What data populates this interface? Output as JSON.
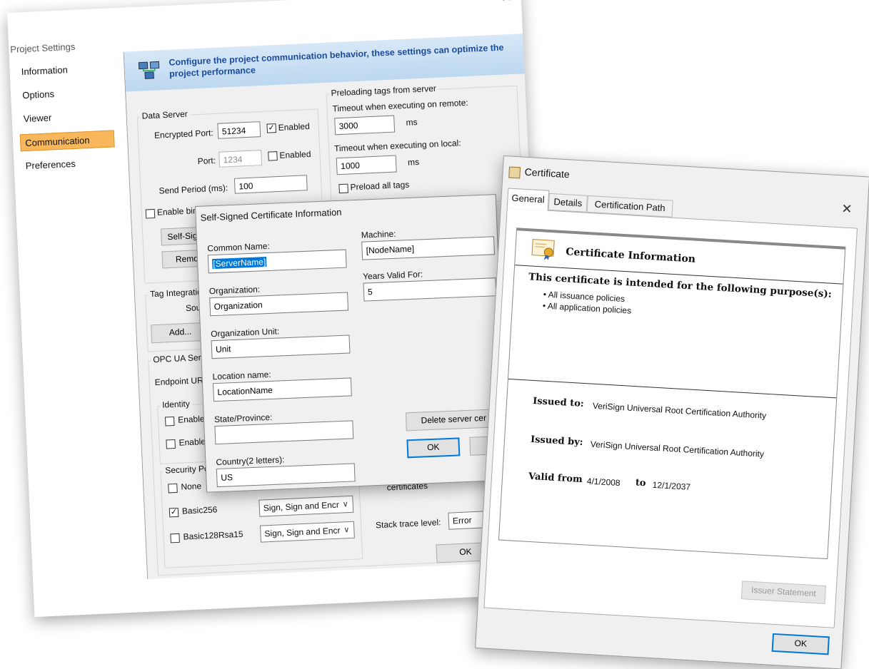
{
  "project_settings": {
    "title": "Project Settings",
    "nav": [
      "Information",
      "Options",
      "Viewer",
      "Communication",
      "Preferences"
    ],
    "active_nav": "Communication",
    "banner": "Configure the project communication behavior, these settings can optimize the project performance",
    "data_server": {
      "title": "Data Server",
      "encrypted_port_label": "Encrypted Port:",
      "encrypted_port_value": "51234",
      "enabled_label": "Enabled",
      "port_label": "Port:",
      "port_value": "1234",
      "send_period_label": "Send Period (ms):",
      "send_period_value": "100",
      "binary_label": "Enable binary control",
      "self_signed_btn": "Self-Signed",
      "remote_btn": "Remote"
    },
    "preloading": {
      "title": "Preloading tags from server",
      "remote_label": "Timeout when executing on remote:",
      "remote_value": "3000",
      "ms": "ms",
      "local_label": "Timeout when executing on local:",
      "local_value": "1000",
      "preload_label": "Preload all tags"
    },
    "tag_integration": {
      "title": "Tag Integration",
      "source": "Source",
      "add_btn": "Add..."
    },
    "opc": {
      "title": "OPC UA Server",
      "endpoint_label": "Endpoint URL:",
      "identity_title": "Identity",
      "enable_an": "Enable an",
      "enable_us": "Enable Us",
      "security_title": "Security Polic",
      "none": "None",
      "basic256": "Basic256",
      "basic128": "Basic128Rsa15",
      "mode_value": "Sign, Sign and Encr",
      "certificates": "certificates",
      "stack_label": "Stack trace level:",
      "stack_value": "Error"
    },
    "ok": "OK"
  },
  "self_signed": {
    "title": "Self-Signed Certificate Information",
    "common_name_label": "Common Name:",
    "common_name_value": "[ServerName]",
    "organization_label": "Organization:",
    "organization_value": "Organization",
    "unit_label": "Organization Unit:",
    "unit_value": "Unit",
    "location_label": "Location name:",
    "location_value": "LocationName",
    "state_label": "State/Province:",
    "state_value": "",
    "country_label": "Country(2 letters):",
    "country_value": "US",
    "machine_label": "Machine:",
    "machine_value": "[NodeName]",
    "years_label": "Years Valid For:",
    "years_value": "5",
    "delete_btn": "Delete server cer",
    "ok": "OK"
  },
  "certificate": {
    "title": "Certificate",
    "tabs": [
      "General",
      "Details",
      "Certification Path"
    ],
    "heading": "Certificate Information",
    "purpose_heading": "This certificate is intended for the following purpose(s):",
    "purposes": [
      "• All issuance policies",
      "• All application policies"
    ],
    "issued_to_label": "Issued to:",
    "issued_to_value": "VeriSign Universal Root Certification Authority",
    "issued_by_label": "Issued by:",
    "issued_by_value": "VeriSign Universal Root Certification Authority",
    "valid_from_label": "Valid from",
    "valid_from": "4/1/2008",
    "to_label": "to",
    "valid_to": "12/1/2037",
    "issuer_btn": "Issuer Statement",
    "ok": "OK"
  }
}
